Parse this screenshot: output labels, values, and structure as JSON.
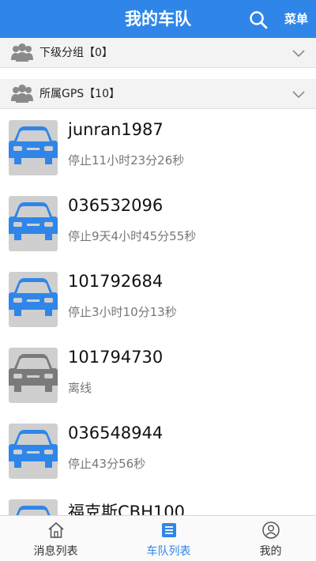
{
  "header": {
    "title": "我的车队",
    "menu_label": "菜单",
    "accent_color": "#2f86e8"
  },
  "groups": [
    {
      "label": "下级分组【0】",
      "icon": "group-icon"
    },
    {
      "label": "所属GPS【10】",
      "icon": "group-icon"
    }
  ],
  "vehicles": [
    {
      "name": "junran1987",
      "status": "停止11小时23分26秒",
      "color": "#2f86e8"
    },
    {
      "name": "036532096",
      "status": "停止9天4小时45分55秒",
      "color": "#2f86e8"
    },
    {
      "name": "101792684",
      "status": "停止3小时10分13秒",
      "color": "#2f86e8"
    },
    {
      "name": "101794730",
      "status": "离线",
      "color": "#7a7a7a"
    },
    {
      "name": "036548944",
      "status": "停止43分56秒",
      "color": "#2f86e8"
    },
    {
      "name": "福克斯CBH100",
      "status": "",
      "color": "#2f86e8"
    }
  ],
  "tabs": [
    {
      "label": "消息列表",
      "icon": "home-icon",
      "active": false
    },
    {
      "label": "车队列表",
      "icon": "list-icon",
      "active": true
    },
    {
      "label": "我的",
      "icon": "user-icon",
      "active": false
    }
  ]
}
